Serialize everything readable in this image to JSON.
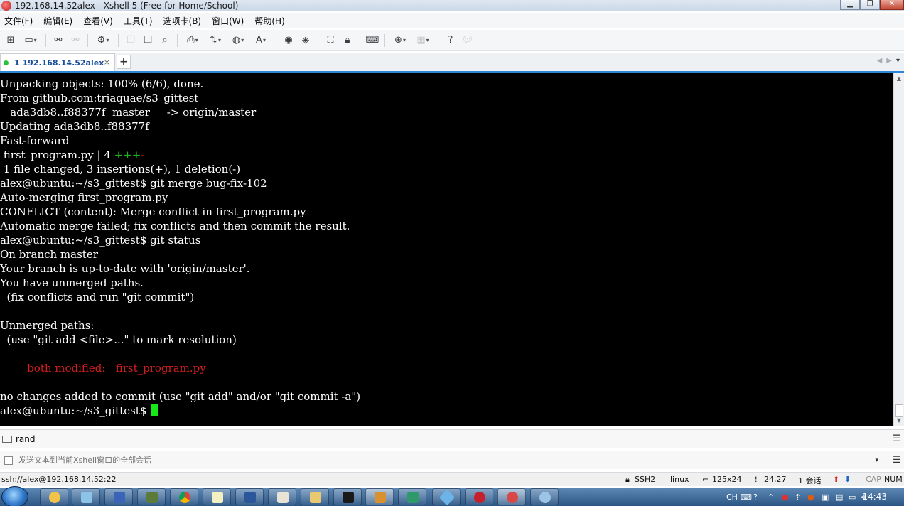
{
  "window": {
    "title": "192.168.14.52alex - Xshell 5 (Free for Home/School)"
  },
  "menu": {
    "items": [
      "文件(F)",
      "编辑(E)",
      "查看(V)",
      "工具(T)",
      "选项卡(B)",
      "窗口(W)",
      "帮助(H)"
    ]
  },
  "tab": {
    "label": "1 192.168.14.52alex",
    "close": "×",
    "add": "+"
  },
  "terminal": {
    "lines": [
      {
        "text": "Unpacking objects: 100% (6/6), done."
      },
      {
        "text": "From github.com:triaquae/s3_gittest"
      },
      {
        "text": "   ada3db8..f88377f  master     -> origin/master"
      },
      {
        "text": "Updating ada3db8..f88377f"
      },
      {
        "text": "Fast-forward"
      },
      {
        "text": " first_program.py | 4 ",
        "plus": "+++",
        "minus": "-"
      },
      {
        "text": " 1 file changed, 3 insertions(+), 1 deletion(-)"
      },
      {
        "text": "alex@ubuntu:~/s3_gittest$ git merge bug-fix-102"
      },
      {
        "text": "Auto-merging first_program.py"
      },
      {
        "text": "CONFLICT (content): Merge conflict in first_program.py"
      },
      {
        "text": "Automatic merge failed; fix conflicts and then commit the result."
      },
      {
        "text": "alex@ubuntu:~/s3_gittest$ git status"
      },
      {
        "text": "On branch master"
      },
      {
        "text": "Your branch is up-to-date with 'origin/master'."
      },
      {
        "text": "You have unmerged paths."
      },
      {
        "text": "  (fix conflicts and run \"git commit\")"
      },
      {
        "text": ""
      },
      {
        "text": "Unmerged paths:"
      },
      {
        "text": "  (use \"git add <file>...\" to mark resolution)"
      },
      {
        "text": ""
      },
      {
        "text": "        ",
        "red": "both modified:   first_program.py"
      },
      {
        "text": ""
      },
      {
        "text": "no changes added to commit (use \"git add\" and/or \"git commit -a\")"
      },
      {
        "text": "alex@ubuntu:~/s3_gittest$ ",
        "cursor": true
      }
    ]
  },
  "quickbar": {
    "label": "rand"
  },
  "compose": {
    "placeholder": "发送文本到当前Xshell窗口的全部会话"
  },
  "status": {
    "connection": "ssh://alex@192.168.14.52:22",
    "protocol": "SSH2",
    "os": "linux",
    "size": "125x24",
    "position": "24,27",
    "sessions": "1 会话",
    "caps": "CAP",
    "num": "NUM"
  },
  "taskbar": {
    "time": "14:43",
    "lang": "CH"
  },
  "colors": {
    "accent": "#2c86d8",
    "terminal_bg": "#000000",
    "terminal_fg": "#ffffff",
    "diff_add": "#20b020",
    "diff_del": "#d21e1e",
    "cursor": "#17e817"
  }
}
